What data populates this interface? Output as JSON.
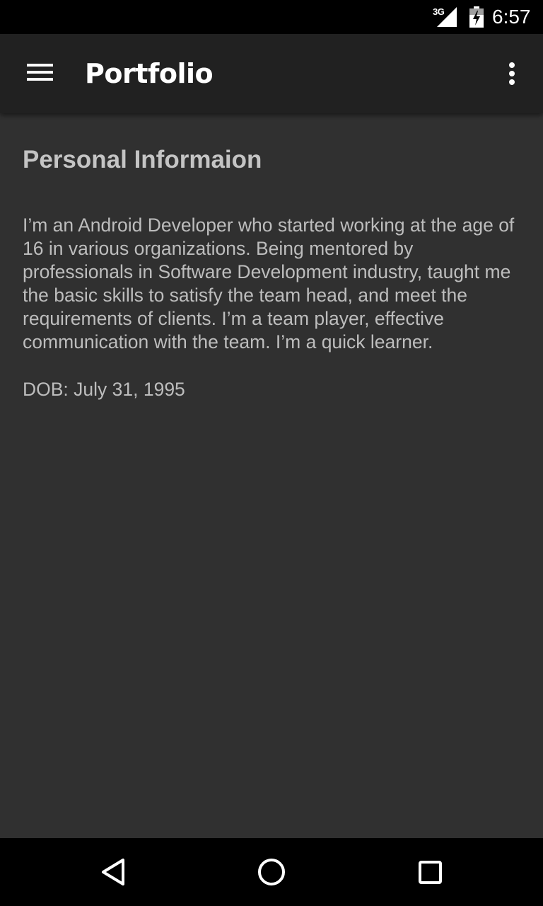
{
  "status_bar": {
    "network": "3G",
    "time": "6:57"
  },
  "app_bar": {
    "title": "Portfolio",
    "menu_icon": "hamburger-menu-icon",
    "overflow_icon": "more-vert-icon"
  },
  "content": {
    "heading": "Personal Informaion",
    "bio": "I’m an Android Developer who started working at the age of 16 in various organizations. Being mentored by professionals in Software Development industry, taught me the basic skills to satisfy the team head, and meet the requirements of clients. I’m a team player, effective communication with the team. I’m a quick learner.",
    "dob": "DOB: July 31, 1995"
  },
  "nav_bar": {
    "back_icon": "back-triangle-icon",
    "home_icon": "home-circle-icon",
    "recents_icon": "recents-square-icon"
  },
  "colors": {
    "status_bar": "#000000",
    "app_bar": "#212121",
    "background": "#303030",
    "text_primary": "#ffffff",
    "text_secondary": "#bdbdbd"
  }
}
